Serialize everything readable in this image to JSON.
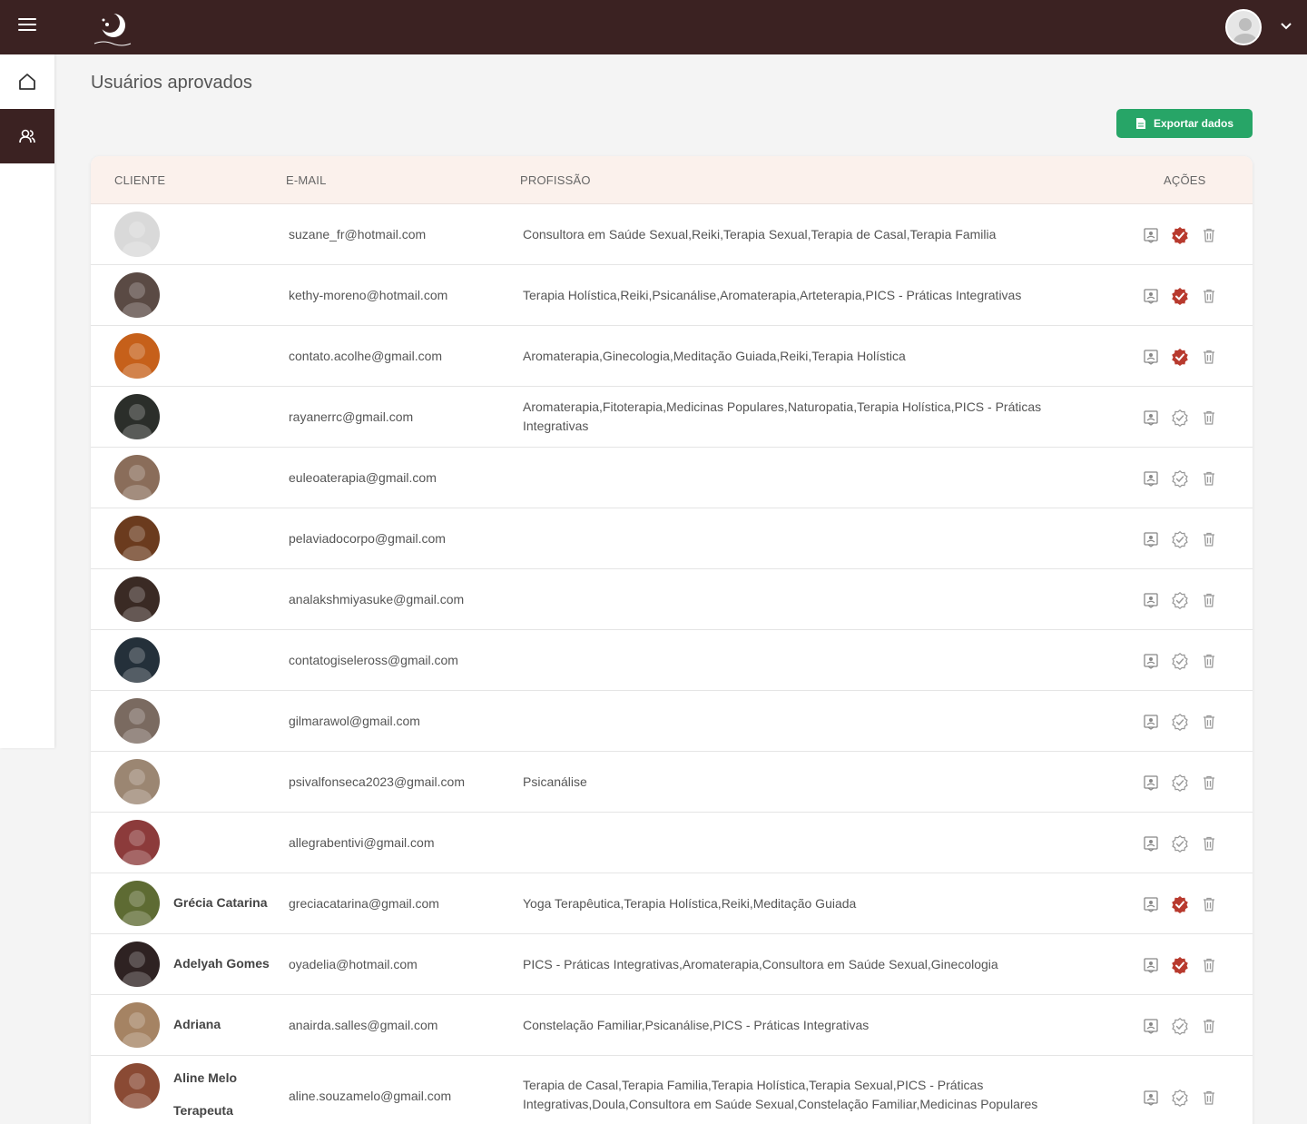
{
  "page": {
    "title": "Usuários aprovados"
  },
  "toolbar": {
    "export_label": "Exportar dados"
  },
  "colors": {
    "topbar": "#3b2222",
    "export": "#27a567",
    "approved": "#b83a2e",
    "header_bg": "#fbf1ec"
  },
  "table": {
    "headers": {
      "client": "CLIENTE",
      "email": "E-MAIL",
      "profession": "PROFISSÃO",
      "actions": "AÇÕES"
    },
    "rows": [
      {
        "name": "",
        "email": "suzane_fr@hotmail.com",
        "profession": "Consultora em Saúde Sexual,Reiki,Terapia Sexual,Terapia de Casal,Terapia Familia",
        "approved": true,
        "avatar_color": "#d9d9d9"
      },
      {
        "name": "",
        "email": "kethy-moreno@hotmail.com",
        "profession": "Terapia Holística,Reiki,Psicanálise,Aromaterapia,Arteterapia,PICS - Práticas Integrativas",
        "approved": true,
        "avatar_color": "#5a4a44"
      },
      {
        "name": "",
        "email": "contato.acolhe@gmail.com",
        "profession": "Aromaterapia,Ginecologia,Meditação Guiada,Reiki,Terapia Holística",
        "approved": true,
        "avatar_color": "#c6601a"
      },
      {
        "name": "",
        "email": "rayanerrc@gmail.com",
        "profession": "Aromaterapia,Fitoterapia,Medicinas Populares,Naturopatia,Terapia Holística,PICS - Práticas Integrativas",
        "approved": false,
        "avatar_color": "#2b2e2a"
      },
      {
        "name": "",
        "email": "euleoaterapia@gmail.com",
        "profession": "",
        "approved": false,
        "avatar_color": "#8a6d5a"
      },
      {
        "name": "",
        "email": "pelaviadocorpo@gmail.com",
        "profession": "",
        "approved": false,
        "avatar_color": "#6b3b1e"
      },
      {
        "name": "",
        "email": "analakshmiyasuke@gmail.com",
        "profession": "",
        "approved": false,
        "avatar_color": "#3a2a24"
      },
      {
        "name": "",
        "email": "contatogiseleross@gmail.com",
        "profession": "",
        "approved": false,
        "avatar_color": "#24303a"
      },
      {
        "name": "",
        "email": "gilmarawol@gmail.com",
        "profession": "",
        "approved": false,
        "avatar_color": "#7a6a60"
      },
      {
        "name": "",
        "email": "psivalfonseca2023@gmail.com",
        "profession": "Psicanálise",
        "approved": false,
        "avatar_color": "#9b8672"
      },
      {
        "name": "",
        "email": "allegrabentivi@gmail.com",
        "profession": "",
        "approved": false,
        "avatar_color": "#8c3b3b"
      },
      {
        "name": "Grécia Catarina",
        "email": "greciacatarina@gmail.com",
        "profession": "Yoga Terapêutica,Terapia Holística,Reiki,Meditação Guiada",
        "approved": true,
        "avatar_color": "#5e6b33"
      },
      {
        "name": "Adelyah Gomes",
        "email": "oyadelia@hotmail.com",
        "profession": "PICS - Práticas Integrativas,Aromaterapia,Consultora em Saúde Sexual,Ginecologia",
        "approved": true,
        "avatar_color": "#2e2222"
      },
      {
        "name": "Adriana",
        "email": "anairda.salles@gmail.com",
        "profession": "Constelação Familiar,Psicanálise,PICS - Práticas Integrativas",
        "approved": false,
        "avatar_color": "#a58363"
      },
      {
        "name": "Aline Melo Terapeuta",
        "email": "aline.souzamelo@gmail.com",
        "profession": "Terapia de Casal,Terapia Familia,Terapia Holística,Terapia Sexual,PICS - Práticas Integrativas,Doula,Consultora em Saúde Sexual,Constelação Familiar,Medicinas Populares",
        "approved": false,
        "avatar_color": "#8a4a34"
      }
    ]
  }
}
